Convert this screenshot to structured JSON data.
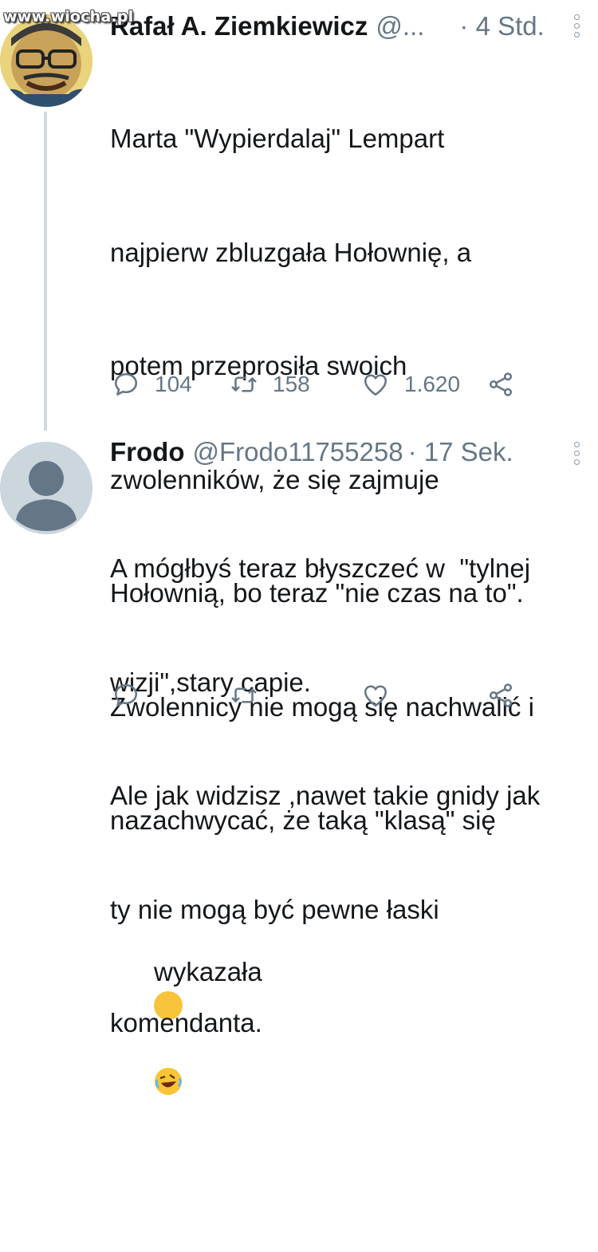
{
  "watermark": "www.wiocha.pl",
  "tweets": [
    {
      "name": "Rafał A. Ziemkiewicz",
      "handle": "@...",
      "time": "· 4 Std.",
      "lines": [
        "Marta \"Wypierdalaj\" Lempart",
        "najpierw zbluzgała Hołownię, a",
        "potem przeprosiła swoich",
        "zwolenników, że się zajmuje",
        "Hołownią, bo teraz \"nie czas na to\".",
        "Zwolennicy nie mogą się nachwalić i",
        "nazachwycać, że taką \"klasą\" się",
        "wykazała"
      ],
      "emoji": "rolling-on-floor-laughing",
      "replies": "104",
      "retweets": "158",
      "likes": "1.620"
    },
    {
      "name": "Frodo",
      "handle": "@Frodo11755258",
      "time": "· 17 Sek.",
      "lines": [
        "A mógłbyś teraz błyszczeć w  \"tylnej",
        "wizji\",stary capie.",
        "Ale jak widzisz ,nawet takie gnidy jak",
        "ty nie mogą być pewne łaski",
        "komendanta."
      ]
    }
  ],
  "icons": {
    "reply": "reply-icon",
    "retweet": "retweet-icon",
    "like": "like-icon",
    "share": "share-icon",
    "more": "more-options-icon"
  },
  "colors": {
    "text": "#14171a",
    "muted": "#657786",
    "thread": "#cfd9de"
  }
}
